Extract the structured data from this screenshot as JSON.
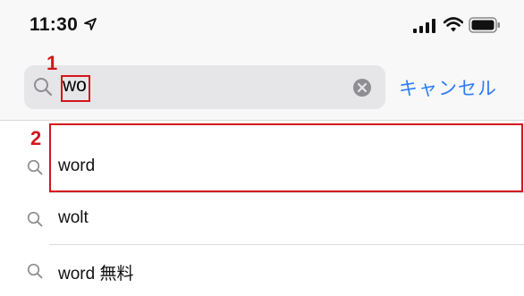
{
  "status_bar": {
    "time": "11:30",
    "icons": [
      "location-arrow-icon",
      "signal-icon",
      "wifi-icon",
      "battery-icon"
    ]
  },
  "search": {
    "value": "wo",
    "cancel_label": "キャンセル"
  },
  "suggestions": [
    {
      "label": "word"
    },
    {
      "label": "wolt"
    },
    {
      "label": "word 無料"
    }
  ],
  "annotations": {
    "step1": "1",
    "step2": "2",
    "color": "#d5151c"
  },
  "colors": {
    "accent": "#2f7cf6",
    "search_field": "#e6e6e9"
  }
}
